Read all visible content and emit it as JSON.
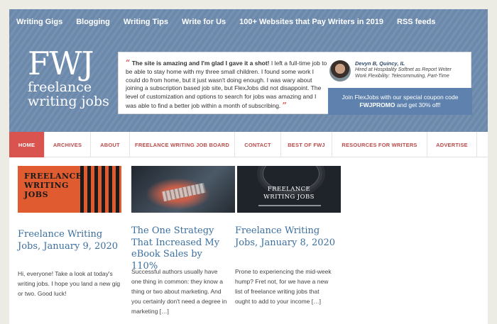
{
  "topnav": {
    "items": [
      "Writing Gigs",
      "Blogging",
      "Writing Tips",
      "Write for Us",
      "100+ Websites that Pay Writers in 2019",
      "RSS feeds"
    ]
  },
  "logo": {
    "abbr": "FWJ",
    "line1": "freelance",
    "line2": "writing jobs"
  },
  "testimonial": {
    "open_quote": "“",
    "close_quote": "”",
    "quote_strong": "The site is amazing and I'm glad I gave it a shot!",
    "quote_rest": " I left a full-time job to be able to stay home with my three small children. I found some work I could do from home, but it just wasn't doing enough. I was wary about joining a subscription based job site, but FlexJobs did not disappoint. The level of customization and options to search for jobs was amazing and I was able to find a better job within a month of subscribing.",
    "person_name": "Devyn B, Quincy, IL",
    "person_line1": "Hired at Hospitality Softnet as Report Writer",
    "person_line2": "Work Flexibility: Telecommuting, Part-Time",
    "promo_line1": "Join FlexJobs with our special coupon code",
    "promo_code": "FWJPROMO",
    "promo_line2_rest": " and get 30% off!"
  },
  "mainnav": {
    "items": [
      "HOME",
      "ARCHIVES",
      "ABOUT",
      "FREELANCE WRITING JOB BOARD",
      "CONTACT",
      "BEST OF FWJ",
      "RESOURCES FOR WRITERS",
      "ADVERTISE"
    ],
    "active": "HOME"
  },
  "posts": [
    {
      "thumb_text": "FREELANCE WRITING JOBS",
      "title": "Freelance Writing Jobs, January 9, 2020",
      "excerpt": "Hi, everyone! Take a look at today's writing jobs. I hope you land a new gig or two. Good luck!"
    },
    {
      "title": "The One Strategy That Increased My eBook Sales by 110%",
      "excerpt": "Successful authors usually have one thing in common: they know a thing or two about marketing. And you certainly don't need a degree in marketing […]"
    },
    {
      "thumb_text": "FREELANCE WRITING JOBS",
      "title": "Freelance Writing Jobs, January 8, 2020",
      "excerpt": "Prone to experiencing the mid-week hump? Fret not, for we have a new list of freelance writing jobs that ought to add to your income […]"
    }
  ],
  "colors": {
    "header_blue": "#6f8db0",
    "accent_red": "#d9534f",
    "link_blue": "#3b6fa0",
    "promo_blue": "#5e82ad"
  }
}
